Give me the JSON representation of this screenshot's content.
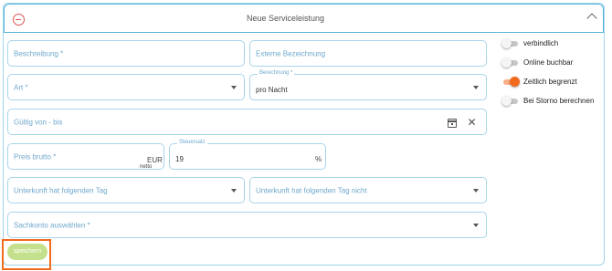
{
  "header": {
    "title": "Neue Serviceleistung"
  },
  "form": {
    "beschreibung_placeholder": "Beschreibung *",
    "externe_bezeichnung_placeholder": "Externe Bezeichnung",
    "art_placeholder": "Art *",
    "berechnung_label": "Berechnung *",
    "berechnung_value": "pro Nacht",
    "gueltig_placeholder": "Gültig von - bis",
    "preis_placeholder": "Preis brutto *",
    "preis_currency": "EUR",
    "preis_netto_hint": "netto",
    "steuersatz_label": "Steuersatz",
    "steuersatz_value": "19",
    "steuersatz_unit": "%",
    "unterkunft_tag_placeholder": "Unterkunft hat folgenden Tag",
    "unterkunft_tag_nicht_placeholder": "Unterkunft hat folgenden Tag nicht",
    "sachkonto_placeholder": "Sachkonto auswählen *",
    "save_label": "speichern"
  },
  "toggles": [
    {
      "label": "verbindlich",
      "on": false
    },
    {
      "label": "Online buchbar",
      "on": false
    },
    {
      "label": "Zeitlich begrenzt",
      "on": true
    },
    {
      "label": "Bei Storno berechnen",
      "on": false
    }
  ],
  "colors": {
    "accent": "#f26b1d",
    "field_border": "#a8d4ea",
    "label": "#6fa8cc",
    "save_button": "#c5e08c"
  },
  "icons": [
    "remove-circle-icon",
    "chevron-up-icon",
    "dropdown-caret-icon",
    "calendar-icon",
    "close-icon"
  ]
}
